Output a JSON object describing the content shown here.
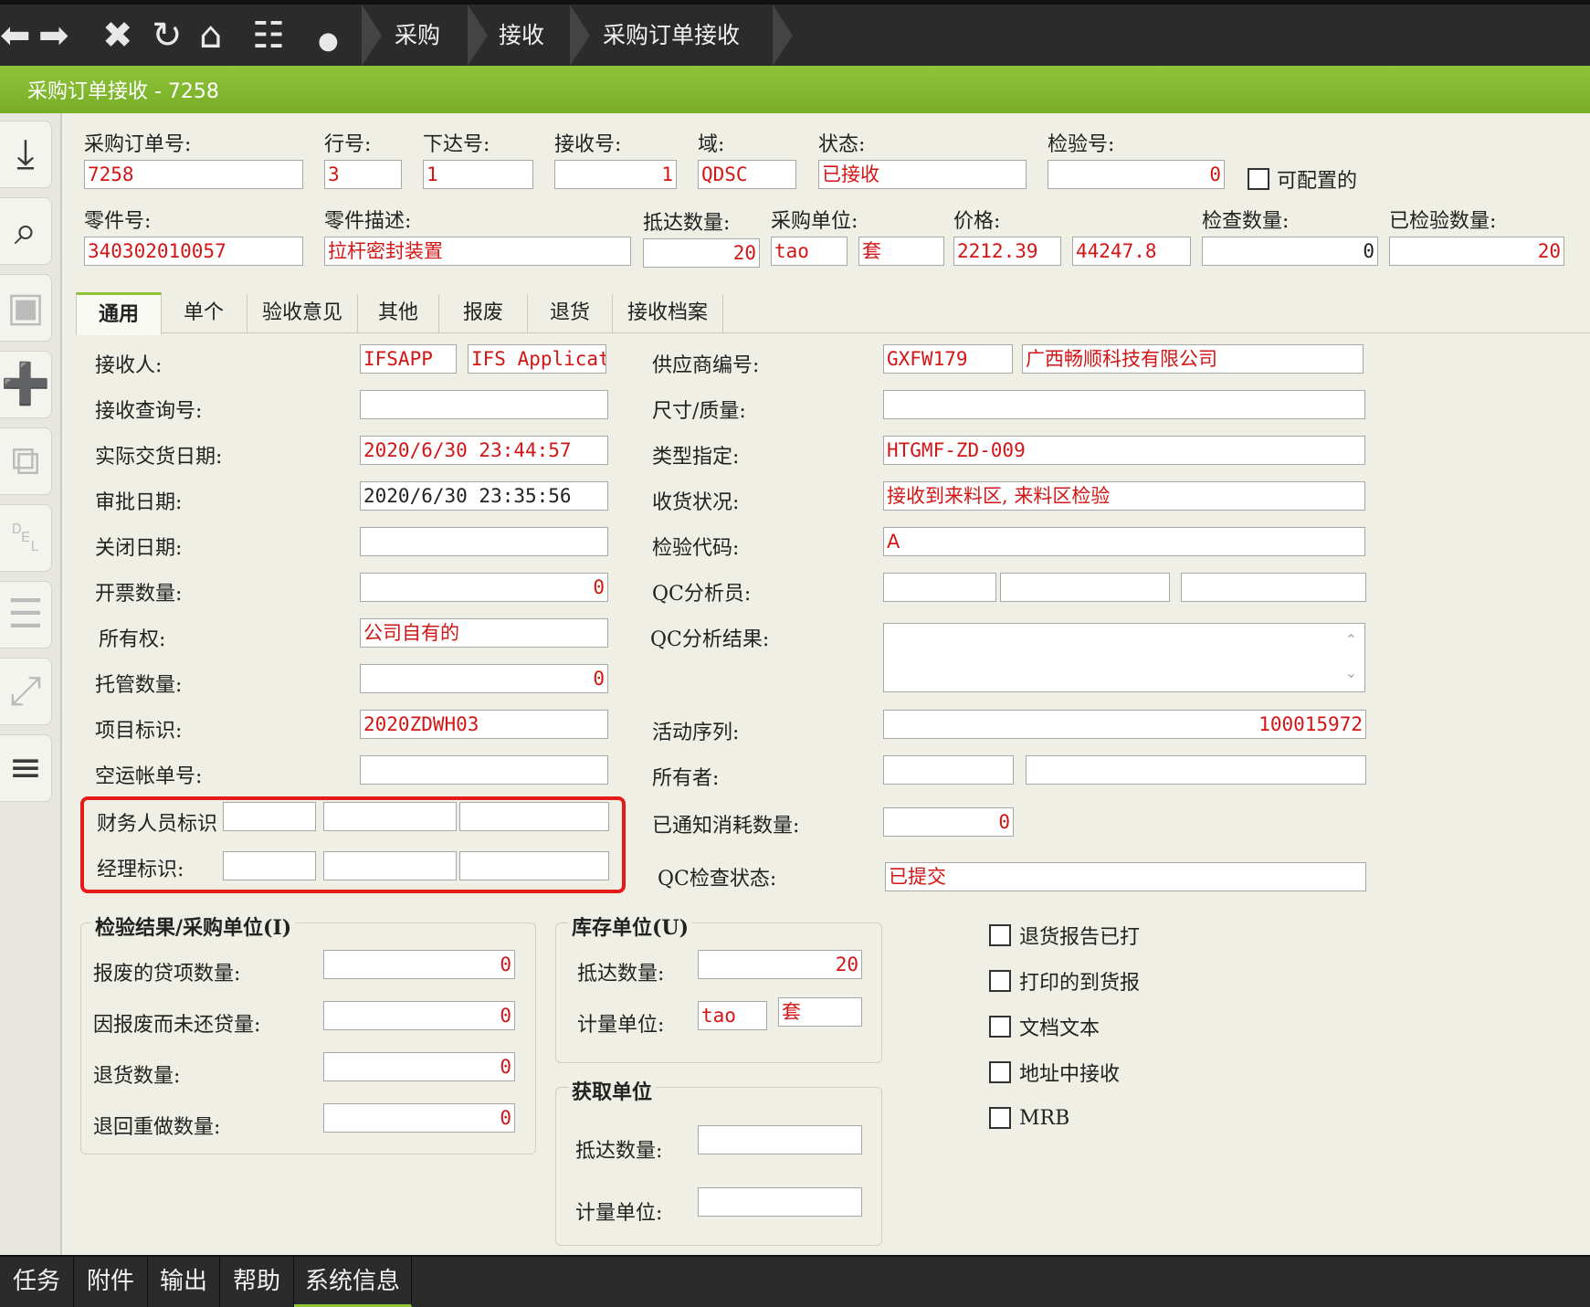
{
  "breadcrumb": [
    "采购",
    "接收",
    "采购订单接收"
  ],
  "window_title": "采购订单接收 - 7258",
  "header": {
    "po_no": {
      "label": "采购订单号:",
      "value": "7258"
    },
    "line_no": {
      "label": "行号:",
      "value": "3"
    },
    "release_no": {
      "label": "下达号:",
      "value": "1"
    },
    "receipt_no": {
      "label": "接收号:",
      "value": "1"
    },
    "site": {
      "label": "域:",
      "value": "QDSC"
    },
    "status": {
      "label": "状态:",
      "value": "已接收"
    },
    "inspection_no": {
      "label": "检验号:",
      "value": "0"
    },
    "configurable": {
      "label": "可配置的",
      "checked": false
    },
    "part_no": {
      "label": "零件号:",
      "value": "340302010057"
    },
    "part_desc": {
      "label": "零件描述:",
      "value": "拉杆密封装置"
    },
    "arrived_qty": {
      "label": "抵达数量:",
      "value": "20"
    },
    "purch_unit": {
      "label": "采购单位:",
      "value": "tao",
      "value2": "套"
    },
    "price": {
      "label": "价格:",
      "value": "2212.39",
      "value2": "44247.8"
    },
    "checked_qty": {
      "label": "检查数量:",
      "value": "0"
    },
    "inspected_qty": {
      "label": "已检验数量:",
      "value": "20"
    }
  },
  "tabs": [
    "通用",
    "单个",
    "验收意见",
    "其他",
    "报废",
    "退货",
    "接收档案"
  ],
  "general": {
    "receiver": {
      "label": "接收人:",
      "value": "IFSAPP",
      "value2": "IFS Applicat"
    },
    "receipt_ref": {
      "label": "接收查询号:",
      "value": ""
    },
    "actual_delivery_date": {
      "label": "实际交货日期:",
      "value": "2020/6/30 23:44:57"
    },
    "approval_date": {
      "label": "审批日期:",
      "value": "2020/6/30 23:35:56"
    },
    "close_date": {
      "label": "关闭日期:",
      "value": ""
    },
    "invoiced_qty": {
      "label": "开票数量:",
      "value": "0"
    },
    "ownership": {
      "label": "所有权:",
      "value": "公司自有的"
    },
    "consign_qty": {
      "label": "托管数量:",
      "value": "0"
    },
    "project_id": {
      "label": "项目标识:",
      "value": "2020ZDWH03"
    },
    "airway_bill": {
      "label": "空运帐单号:",
      "value": ""
    },
    "finance_id": {
      "label": "财务人员标识",
      "values": [
        "",
        "",
        ""
      ]
    },
    "manager_id": {
      "label": "经理标识:",
      "values": [
        "",
        "",
        ""
      ]
    },
    "supplier_no": {
      "label": "供应商编号:",
      "value": "GXFW179",
      "value2": "广西畅顺科技有限公司"
    },
    "size_quality": {
      "label": "尺寸/质量:",
      "value": ""
    },
    "type_designation": {
      "label": "类型指定:",
      "value": "HTGMF-ZD-009"
    },
    "receipt_condition": {
      "label": "收货状况:",
      "value": "接收到来料区, 来料区检验"
    },
    "inspection_code": {
      "label": "检验代码:",
      "value": "A"
    },
    "qc_analyst": {
      "label": "QC分析员:",
      "values": [
        "",
        "",
        ""
      ]
    },
    "qc_result": {
      "label": "QC分析结果:",
      "value": ""
    },
    "activity_seq": {
      "label": "活动序列:",
      "value": "100015972"
    },
    "owner": {
      "label": "所有者:",
      "values": [
        "",
        ""
      ]
    },
    "notified_consumed_qty": {
      "label": "已通知消耗数量:",
      "value": "0"
    },
    "qc_check_status": {
      "label": "QC检查状态:",
      "value": "已提交"
    }
  },
  "inspection_group": {
    "title": "检验结果/采购单位(I)",
    "scrapped_credit_qty": {
      "label": "报废的贷项数量:",
      "value": "0"
    },
    "scrap_not_returned_qty": {
      "label": "因报废而未还贷量:",
      "value": "0"
    },
    "return_qty": {
      "label": "退货数量:",
      "value": "0"
    },
    "return_rework_qty": {
      "label": "退回重做数量:",
      "value": "0"
    }
  },
  "inventory_group": {
    "title": "库存单位(U)",
    "arrived_qty": {
      "label": "抵达数量:",
      "value": "20"
    },
    "uom": {
      "label": "计量单位:",
      "value": "tao",
      "value2": "套"
    }
  },
  "acquire_group": {
    "title": "获取单位",
    "arrived_qty": {
      "label": "抵达数量:",
      "value": ""
    },
    "uom": {
      "label": "计量单位:",
      "value": ""
    }
  },
  "checkboxes": [
    {
      "label": "退货报告已打",
      "checked": false
    },
    {
      "label": "打印的到货报",
      "checked": false
    },
    {
      "label": "文档文本",
      "checked": false
    },
    {
      "label": "地址中接收",
      "checked": false
    },
    {
      "label": "MRB",
      "checked": false
    }
  ],
  "bottom_tabs": [
    "任务",
    "附件",
    "输出",
    "帮助",
    "系统信息"
  ],
  "colors": {
    "accent": "#8ec33a",
    "required_text": "#d31515",
    "highlight_box": "#e51b1b",
    "dark_bar": "#2b2b2b"
  }
}
